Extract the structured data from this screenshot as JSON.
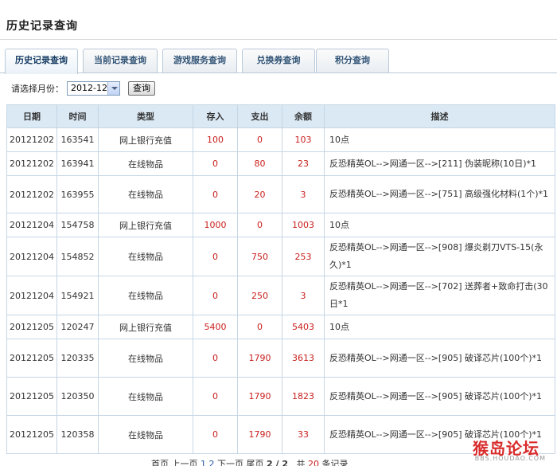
{
  "page_title": "历史记录查询",
  "tabs": [
    {
      "label": "历史记录查询",
      "active": true
    },
    {
      "label": "当前记录查询",
      "active": false
    },
    {
      "label": "游戏服务查询",
      "active": false
    },
    {
      "label": "兑换券查询",
      "active": false
    },
    {
      "label": "积分查询",
      "active": false
    }
  ],
  "filter": {
    "label": "请选择月份：",
    "selected_month": "2012-12",
    "query_button": "查询"
  },
  "table": {
    "headers": [
      "日期",
      "时间",
      "类型",
      "存入",
      "支出",
      "余额",
      "描述"
    ],
    "rows": [
      {
        "date": "20121202",
        "time": "163541",
        "type": "网上银行充值",
        "deposit": "100",
        "expense": "0",
        "balance": "103",
        "desc": "10点"
      },
      {
        "date": "20121202",
        "time": "163941",
        "type": "在线物品",
        "deposit": "0",
        "expense": "80",
        "balance": "23",
        "desc": "反恐精英OL-->网通一区-->[211] 伪装昵称(10日)*1"
      },
      {
        "date": "20121202",
        "time": "163955",
        "type": "在线物品",
        "deposit": "0",
        "expense": "20",
        "balance": "3",
        "desc": "反恐精英OL-->网通一区-->[751] 高级强化材料(1个)*1"
      },
      {
        "date": "20121204",
        "time": "154758",
        "type": "网上银行充值",
        "deposit": "1000",
        "expense": "0",
        "balance": "1003",
        "desc": "10点"
      },
      {
        "date": "20121204",
        "time": "154852",
        "type": "在线物品",
        "deposit": "0",
        "expense": "750",
        "balance": "253",
        "desc": "反恐精英OL-->网通一区-->[908] 爆炎剃刀VTS-15(永久)*1"
      },
      {
        "date": "20121204",
        "time": "154921",
        "type": "在线物品",
        "deposit": "0",
        "expense": "250",
        "balance": "3",
        "desc": "反恐精英OL-->网通一区-->[702] 送葬者+致命打击(30日*1"
      },
      {
        "date": "20121205",
        "time": "120247",
        "type": "网上银行充值",
        "deposit": "5400",
        "expense": "0",
        "balance": "5403",
        "desc": "10点"
      },
      {
        "date": "20121205",
        "time": "120335",
        "type": "在线物品",
        "deposit": "0",
        "expense": "1790",
        "balance": "3613",
        "desc": "反恐精英OL-->网通一区-->[905] 破译芯片(100个)*1"
      },
      {
        "date": "20121205",
        "time": "120350",
        "type": "在线物品",
        "deposit": "0",
        "expense": "1790",
        "balance": "1823",
        "desc": "反恐精英OL-->网通一区-->[905] 破译芯片(100个)*1"
      },
      {
        "date": "20121205",
        "time": "120358",
        "type": "在线物品",
        "deposit": "0",
        "expense": "1790",
        "balance": "33",
        "desc": "反恐精英OL-->网通一区-->[905] 破译芯片(100个)*1"
      }
    ]
  },
  "pager": {
    "first": "首页",
    "prev": "上一页",
    "page_links": "1 2",
    "next": "下一页",
    "last": "尾页",
    "page_status": "2 / 2",
    "total_prefix": "共",
    "total_count": "20",
    "total_suffix": "条记录"
  },
  "watermark": {
    "text": "猴岛论坛",
    "sub": "BBS.HOUDAO.COM"
  },
  "colors": {
    "header_bg": "#dbe9f5",
    "border": "#c6d6e4",
    "amount_red": "#c8201d",
    "tab_text": "#335577"
  }
}
